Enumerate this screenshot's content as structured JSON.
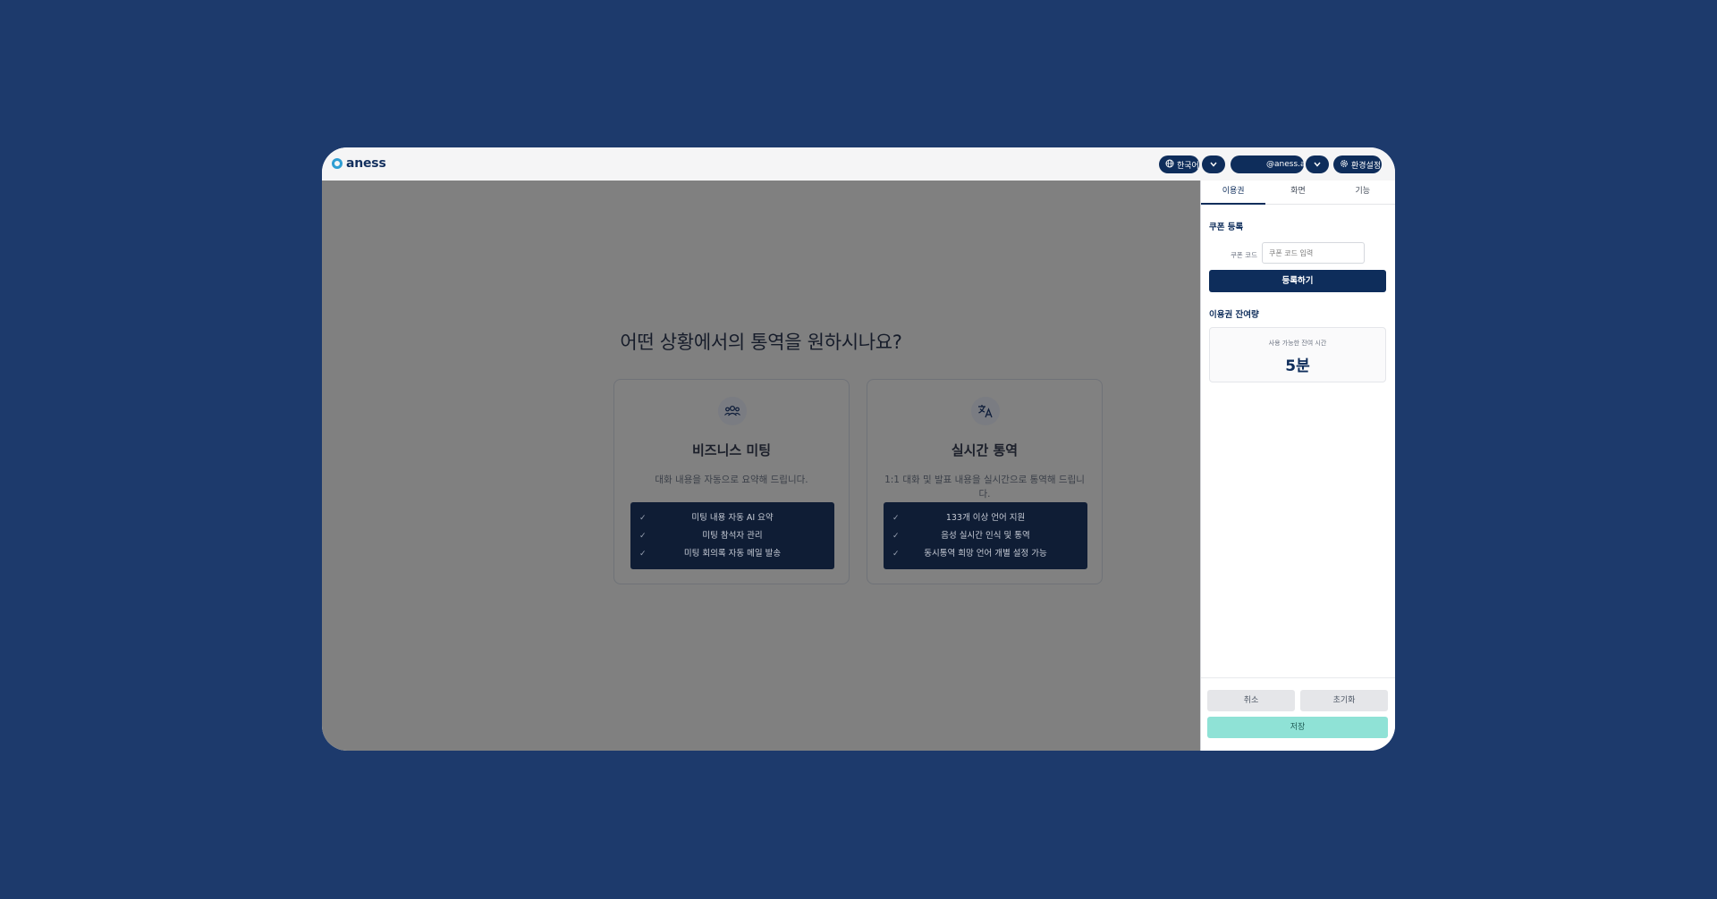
{
  "app": {
    "brand": "aness"
  },
  "header": {
    "language": {
      "icon": "globe-icon",
      "label": "한국어"
    },
    "account": {
      "email": "@aness.ai"
    },
    "settings": {
      "icon": "gear-icon",
      "label": "환경설정"
    }
  },
  "main": {
    "headline": "어떤 상황에서의 통역을 원하시나요?",
    "cards": [
      {
        "icon": "users-icon",
        "title": "비즈니스 미팅",
        "description": "대화 내용을 자동으로 요약해 드립니다.",
        "features": [
          "미팅 내용 자동 AI 요약",
          "미팅 참석자 관리",
          "미팅 회의록 자동 메일 발송"
        ]
      },
      {
        "icon": "translate-icon",
        "title": "실시간 통역",
        "description": "1:1 대화 및 발표 내용을 실시간으로 통역해 드립니다.",
        "features": [
          "133개 이상 언어 지원",
          "음성 실시간 인식 및 통역",
          "동시통역 희망 언어 개별 설정 가능"
        ]
      }
    ]
  },
  "sidebar": {
    "tabs": [
      "이용권",
      "화면",
      "기능"
    ],
    "coupon": {
      "title": "쿠폰 등록",
      "label": "쿠폰 코드",
      "placeholder": "쿠폰 코드 입력",
      "button": "등록하기"
    },
    "remaining": {
      "title": "이용권 잔여량",
      "label": "사용 가능한 잔여 시간",
      "value": "5분"
    },
    "footer": {
      "cancel": "취소",
      "reset": "초기화",
      "save": "저장"
    }
  },
  "colors": {
    "page_bg": "#1d3a6c",
    "navy": "#0e2d5b",
    "save_mint": "#8fe2d6"
  }
}
